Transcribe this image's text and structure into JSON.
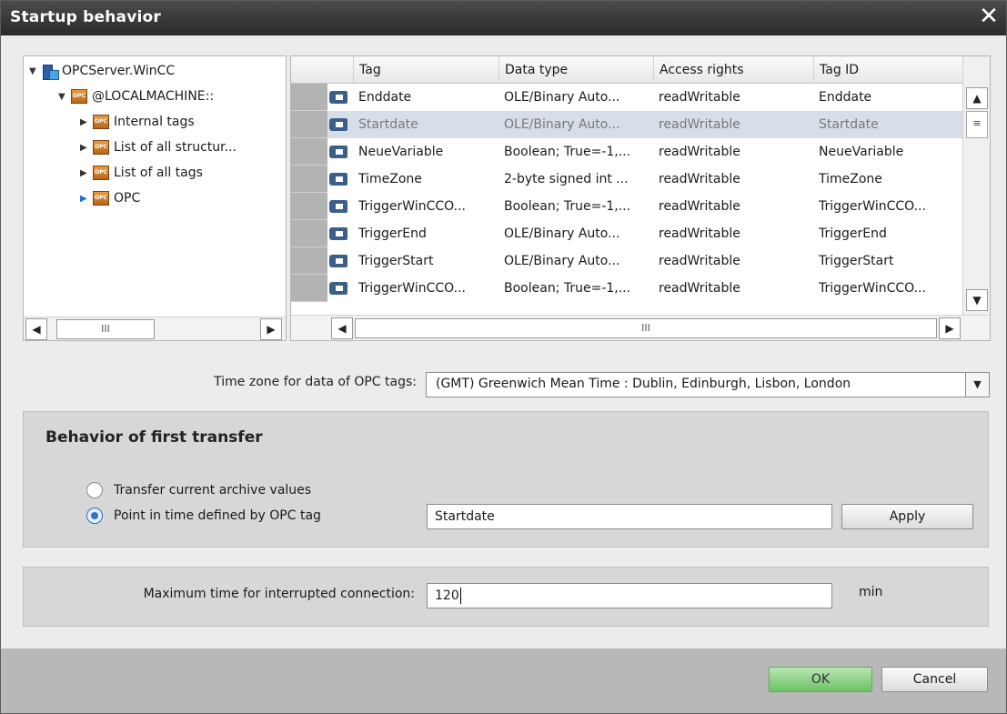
{
  "window": {
    "title": "Startup behavior",
    "close_label": "✕"
  },
  "tree": {
    "items": [
      {
        "label": "OPCServer.WinCC"
      },
      {
        "label": "@LOCALMACHINE::"
      },
      {
        "label": "Internal tags"
      },
      {
        "label": "List of all structur..."
      },
      {
        "label": "List of all tags"
      },
      {
        "label": "OPC"
      }
    ],
    "scroll_thumb": "III"
  },
  "grid": {
    "columns": [
      "Tag",
      "Data type",
      "Access rights",
      "Tag ID"
    ],
    "rows": [
      [
        "Enddate",
        "OLE/Binary Auto...",
        "readWritable",
        "Enddate"
      ],
      [
        "Startdate",
        "OLE/Binary Auto...",
        "readWritable",
        "Startdate"
      ],
      [
        "NeueVariable",
        "Boolean; True=-1,...",
        "readWritable",
        "NeueVariable"
      ],
      [
        "TimeZone",
        "2-byte signed int ...",
        "readWritable",
        "TimeZone"
      ],
      [
        "TriggerWinCCO...",
        "Boolean; True=-1,...",
        "readWritable",
        "TriggerWinCCO..."
      ],
      [
        "TriggerEnd",
        "OLE/Binary Auto...",
        "readWritable",
        "TriggerEnd"
      ],
      [
        "TriggerStart",
        "OLE/Binary Auto...",
        "readWritable",
        "TriggerStart"
      ],
      [
        "TriggerWinCCO...",
        "Boolean; True=-1,...",
        "readWritable",
        "TriggerWinCCO..."
      ]
    ],
    "selected_row": 1,
    "scroll_thumb": "III",
    "vscroll_thumb": "≡"
  },
  "timezone": {
    "label": "Time zone for data of OPC tags:",
    "value": "(GMT) Greenwich Mean Time : Dublin, Edinburgh, Lisbon, London"
  },
  "first_transfer": {
    "title": "Behavior of first transfer",
    "option_current": "Transfer current archive values",
    "option_point": "Point in time defined by OPC tag",
    "tag_value": "Startdate",
    "apply_label": "Apply"
  },
  "max_connection": {
    "label": "Maximum time for interrupted connection:",
    "value": "120",
    "unit": "min"
  },
  "footer": {
    "ok_label": "OK",
    "cancel_label": "Cancel"
  }
}
